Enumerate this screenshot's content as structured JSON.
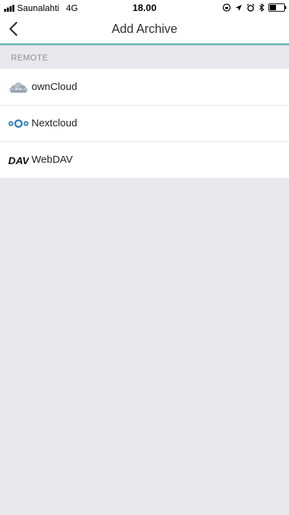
{
  "status_bar": {
    "carrier": "Saunalahti",
    "network": "4G",
    "time": "18.00",
    "battery_level": 0.45
  },
  "navbar": {
    "title": "Add Archive"
  },
  "section": {
    "header": "REMOTE"
  },
  "items": [
    {
      "label": "ownCloud",
      "icon": "owncloud-icon"
    },
    {
      "label": "Nextcloud",
      "icon": "nextcloud-icon"
    },
    {
      "label": "WebDAV",
      "icon": "webdav-icon"
    }
  ],
  "colors": {
    "accent": "#6fb8b5",
    "nextcloud_blue": "#2c7bbd",
    "owncloud_gray": "#9aa5b5"
  }
}
